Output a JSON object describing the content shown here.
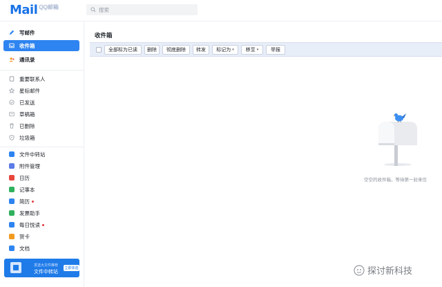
{
  "header": {
    "logo_text": "Mail",
    "logo_sub": "QQ邮箱",
    "search_placeholder": "搜索"
  },
  "sidebar": {
    "primary": [
      {
        "label": "写邮件",
        "icon": "pen-icon"
      },
      {
        "label": "收件箱",
        "icon": "inbox-icon",
        "active": true
      },
      {
        "label": "通讯录",
        "icon": "contacts-icon"
      }
    ],
    "folders": [
      {
        "label": "重要联系人",
        "icon": "bookmark-icon"
      },
      {
        "label": "星标邮件",
        "icon": "star-icon"
      },
      {
        "label": "已发送",
        "icon": "sent-icon"
      },
      {
        "label": "草稿箱",
        "icon": "draft-icon"
      },
      {
        "label": "已删除",
        "icon": "trash-icon"
      },
      {
        "label": "垃圾箱",
        "icon": "spam-shield-icon"
      }
    ],
    "apps": [
      {
        "label": "文件中转站",
        "icon": "file-transfer-icon",
        "color": "#2e84f0"
      },
      {
        "label": "附件管理",
        "icon": "attachment-icon",
        "color": "#5b7be8"
      },
      {
        "label": "日历",
        "icon": "calendar-icon",
        "color": "#e8453c"
      },
      {
        "label": "记事本",
        "icon": "notepad-icon",
        "color": "#2fb15d"
      },
      {
        "label": "简历",
        "icon": "resume-icon",
        "color": "#2e84f0",
        "dot": true
      },
      {
        "label": "发票助手",
        "icon": "invoice-icon",
        "color": "#2fb15d"
      },
      {
        "label": "每日悦读",
        "icon": "reading-icon",
        "color": "#2e84f0",
        "dot": true
      },
      {
        "label": "贺卡",
        "icon": "greeting-card-icon",
        "color": "#f29a1f"
      },
      {
        "label": "文档",
        "icon": "document-icon",
        "color": "#2e84f0"
      }
    ],
    "promo": {
      "small_text": "发送大文件推荐",
      "title": "文件中转站",
      "button": "立即体验"
    }
  },
  "main": {
    "title": "收件箱",
    "toolbar": {
      "mark_all_read": "全部标为已读",
      "delete": "删除",
      "delete_permanently": "彻底删除",
      "forward": "转发",
      "mark_as": "标记为",
      "move_to": "移至",
      "report": "举报"
    },
    "empty_message": "空空的收件箱，等待第一封来信"
  },
  "watermark": "探讨新科技",
  "colors": {
    "accent": "#2e84f0",
    "toolbar_bg": "#e8eef8",
    "notification_dot": "#e5393e"
  }
}
